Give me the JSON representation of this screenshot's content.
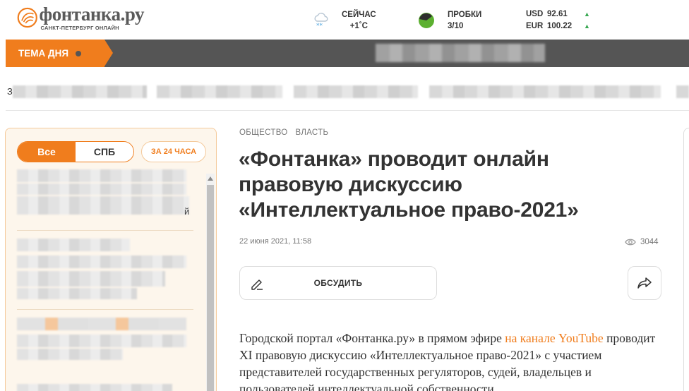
{
  "header": {
    "logo": {
      "name": "фонтанка.ру",
      "subtitle": "САНКТ-ПЕТЕРБУРГ ОНЛАЙН"
    },
    "weather": {
      "label": "СЕЙЧАС",
      "value": "+1˚С",
      "icon": "snow-cloud-icon"
    },
    "traffic": {
      "label": "ПРОБКИ",
      "value": "3/10",
      "icon": "traffic-indicator-icon"
    },
    "currency": [
      {
        "code": "USD",
        "value": "92.61",
        "trend": "▲"
      },
      {
        "code": "EUR",
        "value": "100.22",
        "trend": "▲"
      }
    ]
  },
  "topic_bar": {
    "tag": "ТЕМА ДНЯ"
  },
  "ticker": {
    "first_char": "З"
  },
  "sidebar": {
    "tabs": [
      {
        "label": "Все",
        "active": true
      },
      {
        "label": "СПБ",
        "active": false
      }
    ],
    "last24_label": "ЗА 24 ЧАСА",
    "fragments": [
      "й"
    ]
  },
  "article": {
    "rubrics": [
      "ОБЩЕСТВО",
      "ВЛАСТЬ"
    ],
    "title": "«Фонтанка» проводит онлайн правовую дискуссию «Интеллектуальное право-2021»",
    "date": "22 июня 2021, 11:58",
    "views": "3044",
    "discuss_label": "ОБСУДИТЬ",
    "body": {
      "part1": "Городской портал «Фонтанка.ру» в прямом эфире ",
      "link": "на канале YouTube",
      "part2": " проводит XI правовую дискуссию «Интеллектуальное право-2021» с участием представителей государственных регуляторов, судей, владельцев и пользователей интеллектуальной собственности"
    }
  },
  "colors": {
    "accent": "#f07d1d",
    "bar": "#555555",
    "up": "#3aa853"
  }
}
